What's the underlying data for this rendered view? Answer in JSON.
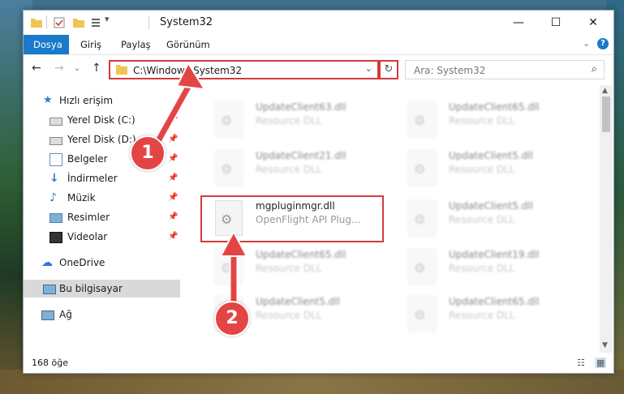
{
  "window": {
    "title": "System32",
    "controls": {
      "minimize": "—",
      "maximize": "☐",
      "close": "✕"
    }
  },
  "ribbon": {
    "tabs": [
      "Dosya",
      "Giriş",
      "Paylaş",
      "Görünüm"
    ]
  },
  "nav": {
    "address": "C:\\Windows\\System32",
    "search_placeholder": "Ara: System32"
  },
  "sidebar": {
    "items": [
      {
        "label": "Hızlı erişim",
        "icon": "star-icon"
      },
      {
        "label": "Yerel Disk (C:)",
        "icon": "drive-icon",
        "pinned": true
      },
      {
        "label": "Yerel Disk (D:)",
        "icon": "drive-icon",
        "pinned": true
      },
      {
        "label": "Belgeler",
        "icon": "documents-icon",
        "pinned": true
      },
      {
        "label": "İndirmeler",
        "icon": "download-icon",
        "pinned": true
      },
      {
        "label": "Müzik",
        "icon": "music-icon",
        "pinned": true
      },
      {
        "label": "Resimler",
        "icon": "pictures-icon",
        "pinned": true
      },
      {
        "label": "Videolar",
        "icon": "video-icon",
        "pinned": true
      },
      {
        "label": "OneDrive",
        "icon": "cloud-icon"
      },
      {
        "label": "Bu bilgisayar",
        "icon": "computer-icon"
      },
      {
        "label": "Ağ",
        "icon": "network-icon"
      }
    ]
  },
  "files": [
    {
      "name": "UpdateClient63.dll",
      "type": "Resource DLL"
    },
    {
      "name": "UpdateClient65.dll",
      "type": "Resource DLL"
    },
    {
      "name": "UpdateClient21.dll",
      "type": "Resource DLL"
    },
    {
      "name": "UpdateClient5.dll",
      "type": "Resource DLL"
    },
    {
      "name": "mgpluginmgr.dll",
      "type": "OpenFlight API Plug..."
    },
    {
      "name": "UpdateClient5.dll",
      "type": "Resource DLL"
    },
    {
      "name": "UpdateClient65.dll",
      "type": "Resource DLL"
    },
    {
      "name": "UpdateClient19.dll",
      "type": "Resource DLL"
    },
    {
      "name": "UpdateClient5.dll",
      "type": "Resource DLL"
    },
    {
      "name": "UpdateClient65.dll",
      "type": "Resource DLL"
    }
  ],
  "status": {
    "count": "168 öğe"
  },
  "callouts": {
    "one": "1",
    "two": "2"
  },
  "colors": {
    "accent": "#1979ca",
    "highlight": "#d33a3a"
  }
}
